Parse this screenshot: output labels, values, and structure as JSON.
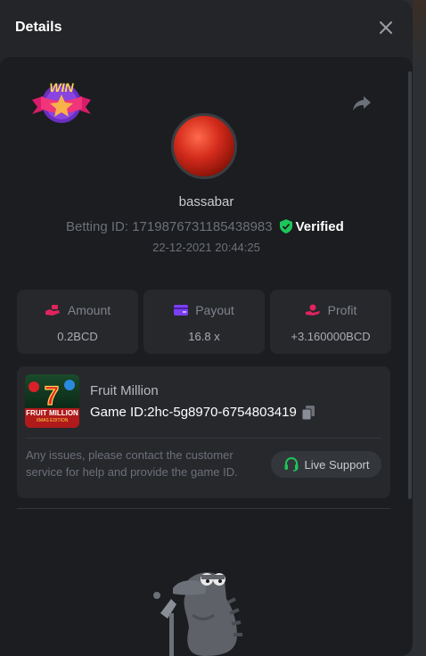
{
  "modal": {
    "title": "Details",
    "close_icon": "close-icon"
  },
  "bet": {
    "badge_text": "WIN",
    "username": "bassabar",
    "betting_id_text": "Betting ID: 1719876731185438983",
    "verified_label": "Verified",
    "datetime": "22-12-2021 20:44:25"
  },
  "stats": [
    {
      "label": "Amount",
      "value": "0.2BCD",
      "icon": "bet-hand-icon",
      "color": "#e0245e"
    },
    {
      "label": "Payout",
      "value": "16.8 x",
      "icon": "wallet-card-icon",
      "color": "#7b3ff2"
    },
    {
      "label": "Profit",
      "value": "+3.160000BCD",
      "icon": "coin-hand-icon",
      "color": "#e0245e"
    }
  ],
  "game": {
    "thumb_title": "FRUIT MILLION",
    "thumb_subtitle": "XMAS EDITION",
    "name": "Fruit Million",
    "id_text": "Game ID:2hc-5g8970-6754803419",
    "help_text": "Any issues, please contact the customer service for help and provide the game ID.",
    "support_label": "Live Support"
  },
  "colors": {
    "verified_green": "#1ec65a",
    "support_green": "#1ec65a",
    "panel_bg": "#1b1d20"
  }
}
